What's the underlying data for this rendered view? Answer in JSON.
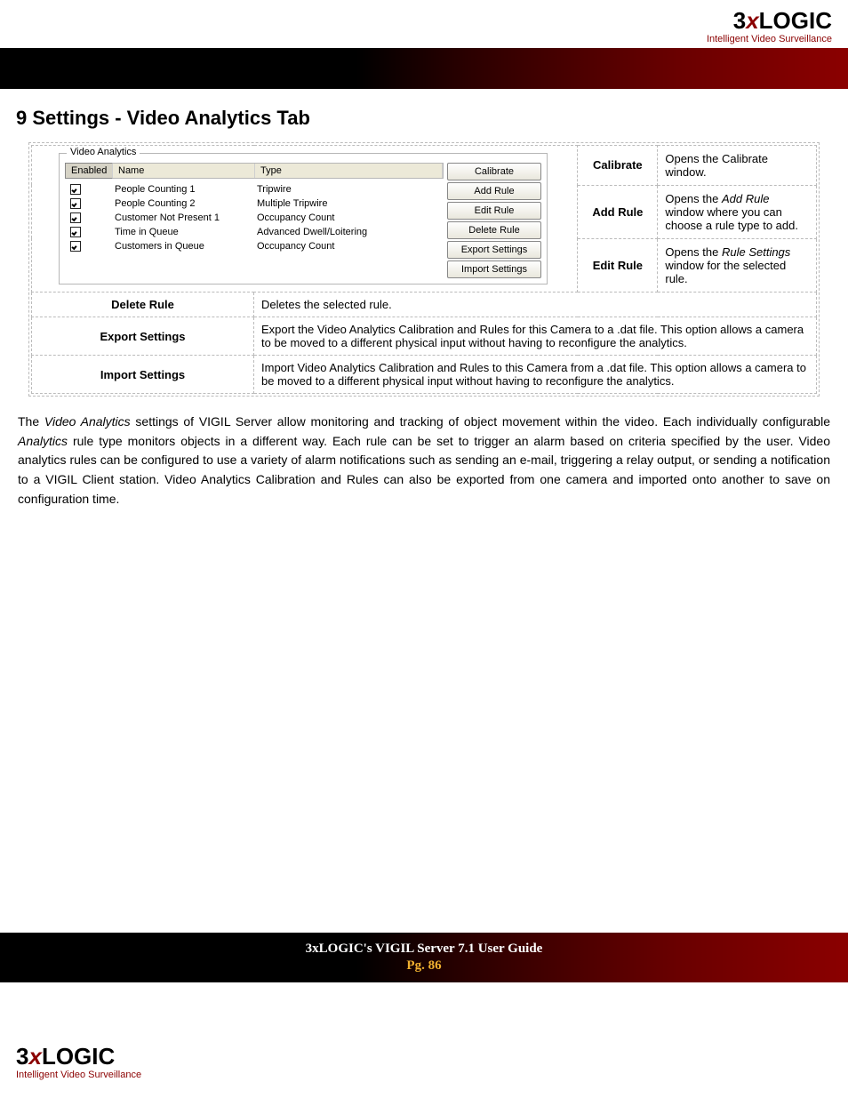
{
  "brand": {
    "three": "3",
    "x": "x",
    "logic": "LOGIC",
    "tagline": "Intelligent Video Surveillance"
  },
  "heading": "9 Settings - Video Analytics Tab",
  "panel": {
    "group_title": "Video Analytics",
    "headers": {
      "enabled": "Enabled",
      "name": "Name",
      "type": "Type"
    },
    "rows": [
      {
        "name": "People Counting 1",
        "type": "Tripwire"
      },
      {
        "name": "People Counting 2",
        "type": "Multiple Tripwire"
      },
      {
        "name": "Customer Not Present 1",
        "type": "Occupancy Count"
      },
      {
        "name": "Time in Queue",
        "type": "Advanced Dwell/Loitering"
      },
      {
        "name": "Customers in Queue",
        "type": "Occupancy Count"
      }
    ],
    "buttons": {
      "calibrate": "Calibrate",
      "add_rule": "Add Rule",
      "edit_rule": "Edit Rule",
      "delete_rule": "Delete Rule",
      "export": "Export Settings",
      "import": "Import Settings"
    }
  },
  "defs": {
    "calibrate": {
      "k": "Calibrate",
      "v": "Opens the Calibrate window."
    },
    "add_rule": {
      "k": "Add Rule",
      "v_pre": "Opens the ",
      "v_em": "Add Rule",
      "v_post": " window where you can choose a rule type to add."
    },
    "edit_rule": {
      "k": "Edit Rule",
      "v_pre": "Opens the ",
      "v_em": "Rule Settings",
      "v_post": " window for the selected rule."
    },
    "delete_rule": {
      "k": "Delete Rule",
      "v": "Deletes the selected rule."
    },
    "export_settings": {
      "k": "Export Settings",
      "v": "Export the Video Analytics Calibration and Rules for this Camera to a .dat file.  This option allows a camera to be moved to a different physical input without having to reconfigure the analytics."
    },
    "import_settings": {
      "k": "Import Settings",
      "v": "Import Video Analytics Calibration and Rules to this Camera from a .dat file.  This option allows a camera to be moved to a different physical input without having to reconfigure the analytics."
    }
  },
  "paragraph": {
    "p1a": "The ",
    "p1em1": "Video Analytics",
    "p1b": " settings of VIGIL Server allow monitoring and tracking of object movement within the video. Each individually configurable ",
    "p1em2": "Analytics",
    "p1c": " rule type monitors objects in a different way. Each rule can be set to trigger an alarm based on criteria specified by the user. Video analytics rules can be configured to use a variety of alarm notifications such as sending an e-mail, triggering a relay output, or sending a notification to a VIGIL Client station.  Video Analytics Calibration and Rules can also be exported from one camera and imported onto another to save on configuration time."
  },
  "footer": {
    "title": "3xLOGIC's VIGIL Server 7.1 User Guide",
    "page": "Pg. 86"
  }
}
